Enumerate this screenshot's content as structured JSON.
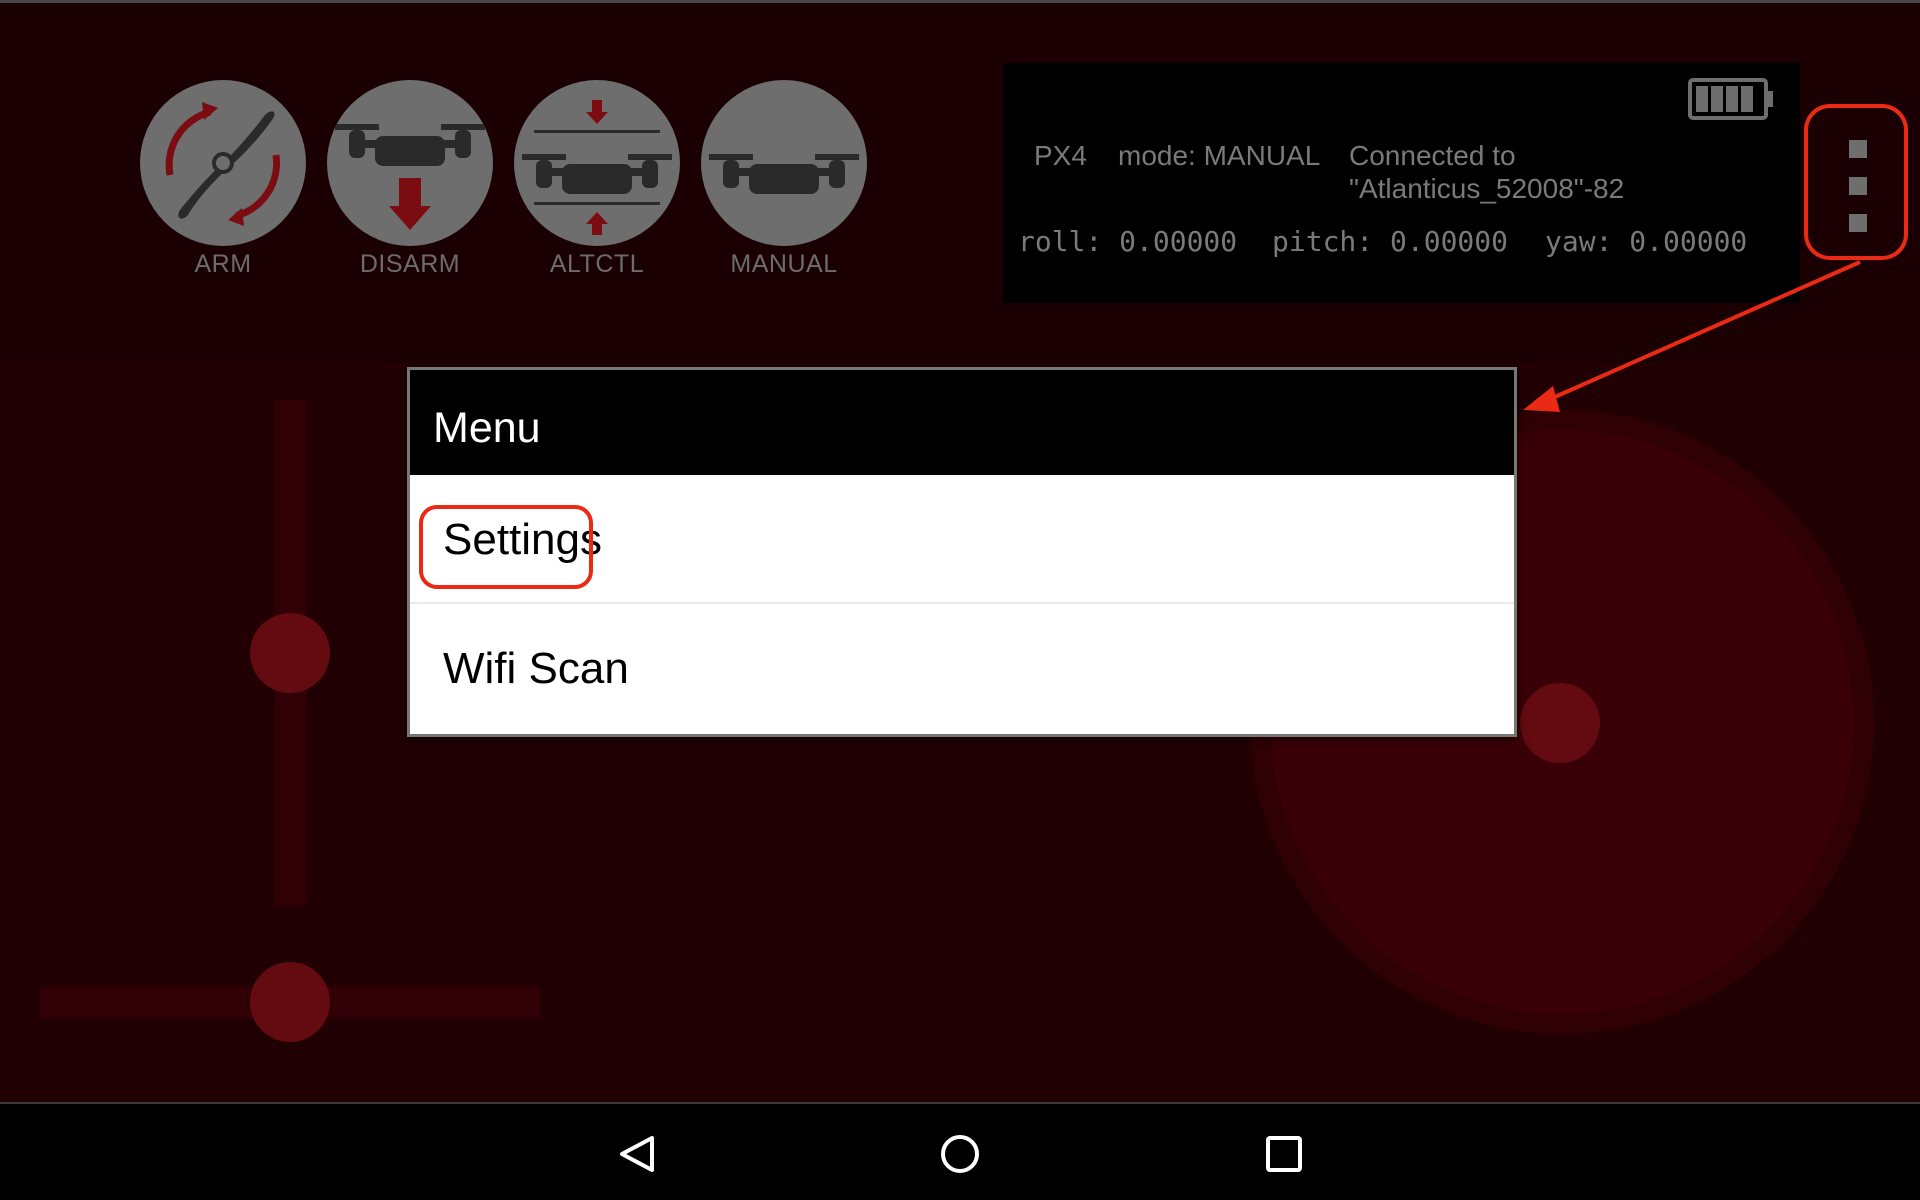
{
  "mode_buttons": [
    {
      "label": "ARM",
      "icon": "propeller-arm-icon"
    },
    {
      "label": "DISARM",
      "icon": "drone-land-icon"
    },
    {
      "label": "ALTCTL",
      "icon": "drone-altitude-icon"
    },
    {
      "label": "MANUAL",
      "icon": "drone-manual-icon"
    }
  ],
  "status": {
    "vehicle": "PX4",
    "mode": "mode: MANUAL",
    "connected_line1": "Connected to",
    "connected_line2": "\"Atlanticus_52008\"-82",
    "roll": "roll: 0.00000",
    "pitch": "pitch: 0.00000",
    "yaw": "yaw: 0.00000",
    "battery_icon": "battery-full-icon"
  },
  "menu": {
    "title": "Menu",
    "items": [
      {
        "label": "Settings"
      },
      {
        "label": "Wifi Scan"
      }
    ]
  },
  "overflow_icon": "more-vert-icon",
  "nav": {
    "back_icon": "back-triangle-icon",
    "home_icon": "home-circle-icon",
    "recents_icon": "recents-square-icon"
  },
  "colors": {
    "annotation": "#ea2a15",
    "background": "#210004",
    "knob": "#630b10"
  }
}
